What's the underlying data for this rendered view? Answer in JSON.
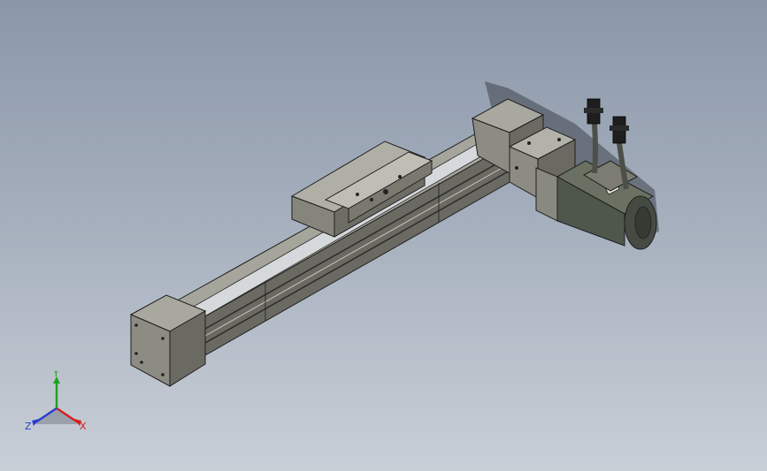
{
  "viewport": {
    "background_top": "#8b97a9",
    "background_bottom": "#c9cfd7"
  },
  "model": {
    "icon": "linear-actuator-model",
    "colors": {
      "housing_top": "#a9a89f",
      "housing_side": "#6b6a62",
      "housing_dark": "#4a4944",
      "rail": "#cfd3d6",
      "motor": "#4f564c",
      "edge": "#1f1f1f",
      "shadow": "#3e434c"
    }
  },
  "triad": {
    "icon": "coordinate-triad-icon",
    "x_label": "X",
    "y_label": "Y",
    "z_label": "Z",
    "x_color": "#d42020",
    "y_color": "#1fa31f",
    "z_color": "#2a3fd0"
  }
}
